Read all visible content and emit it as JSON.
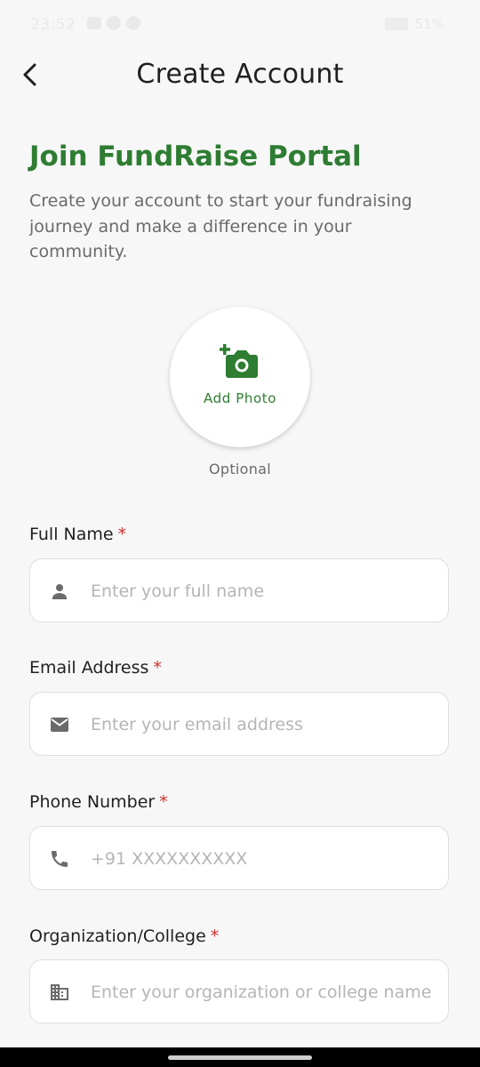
{
  "status_bar": {
    "time": "23:52",
    "battery": "51%"
  },
  "header": {
    "title": "Create Account"
  },
  "intro": {
    "heading": "Join FundRaise Portal",
    "subtitle": "Create your account to start your fundraising journey and make a difference in your community."
  },
  "photo": {
    "label": "Add Photo",
    "optional_text": "Optional"
  },
  "form": {
    "required_mark": "*",
    "full_name": {
      "label": "Full Name",
      "placeholder": "Enter your full name",
      "icon": "person-icon"
    },
    "email": {
      "label": "Email Address",
      "placeholder": "Enter your email address",
      "icon": "email-icon"
    },
    "phone": {
      "label": "Phone Number",
      "placeholder": "+91 XXXXXXXXXX",
      "icon": "phone-icon"
    },
    "organization": {
      "label": "Organization/College",
      "placeholder": "Enter your organization or college name",
      "icon": "building-icon"
    }
  },
  "colors": {
    "accent": "#2e7d32",
    "required": "#d32f2f",
    "background": "#f7f7f7"
  }
}
